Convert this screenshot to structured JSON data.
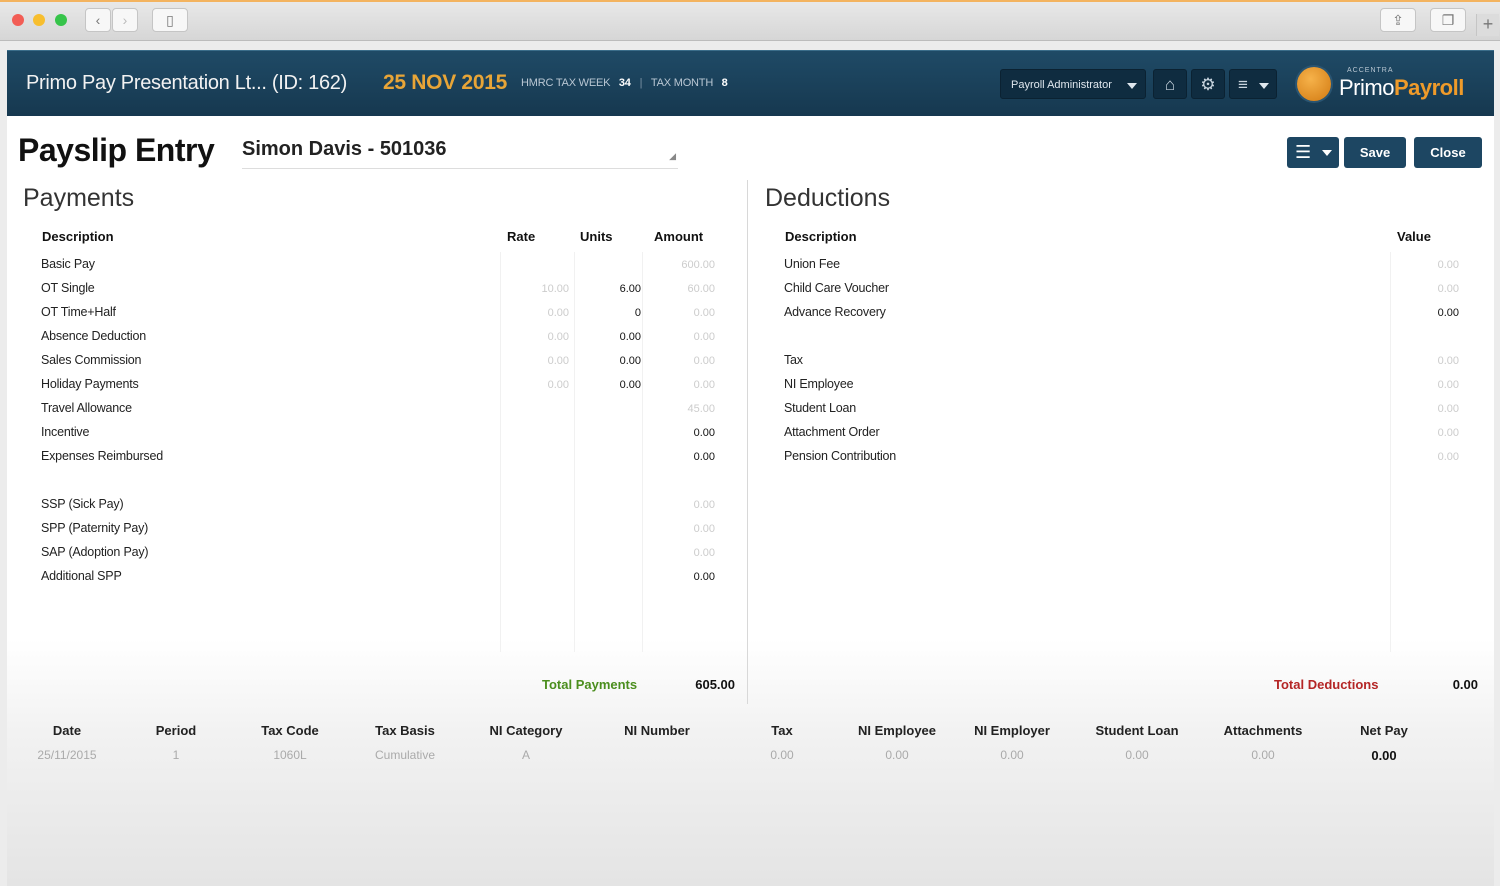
{
  "app": {
    "company": "Primo Pay Presentation Lt... (ID: 162)",
    "date": "25 NOV 2015",
    "hmrc_week_label": "HMRC TAX WEEK",
    "hmrc_week": "34",
    "tax_month_label": "TAX MONTH",
    "tax_month": "8",
    "user_role": "Payroll Administrator",
    "logo_small": "ACCENTRA",
    "logo_primary": "Primo",
    "logo_secondary": "Payroll"
  },
  "page": {
    "title": "Payslip Entry",
    "employee": "Simon Davis - 501036",
    "save_label": "Save",
    "close_label": "Close"
  },
  "payments": {
    "title": "Payments",
    "headers": {
      "description": "Description",
      "rate": "Rate",
      "units": "Units",
      "amount": "Amount"
    },
    "rows": [
      {
        "desc": "Basic Pay",
        "rate": "",
        "units": "",
        "amount": "600.00"
      },
      {
        "desc": "OT Single",
        "rate": "10.00",
        "units": "6.00",
        "amount": "60.00"
      },
      {
        "desc": "OT Time+Half",
        "rate": "0.00",
        "units": "0",
        "amount": "0.00"
      },
      {
        "desc": "Absence Deduction",
        "rate": "0.00",
        "units": "0.00",
        "amount": "0.00"
      },
      {
        "desc": "Sales Commission",
        "rate": "0.00",
        "units": "0.00",
        "amount": "0.00"
      },
      {
        "desc": "Holiday Payments",
        "rate": "0.00",
        "units": "0.00",
        "amount": "0.00"
      },
      {
        "desc": "Travel Allowance",
        "rate": "",
        "units": "",
        "amount": "45.00"
      },
      {
        "desc": "Incentive",
        "rate": "",
        "units": "",
        "amount": "0.00"
      },
      {
        "desc": "Expenses Reimbursed",
        "rate": "",
        "units": "",
        "amount": "0.00"
      },
      {
        "desc": "",
        "rate": "",
        "units": "",
        "amount": ""
      },
      {
        "desc": "SSP (Sick Pay)",
        "rate": "",
        "units": "",
        "amount": "0.00"
      },
      {
        "desc": "SPP (Paternity Pay)",
        "rate": "",
        "units": "",
        "amount": "0.00"
      },
      {
        "desc": "SAP (Adoption Pay)",
        "rate": "",
        "units": "",
        "amount": "0.00"
      },
      {
        "desc": "Additional SPP",
        "rate": "",
        "units": "",
        "amount": "0.00"
      }
    ],
    "total_label": "Total Payments",
    "total_value": "605.00"
  },
  "deductions": {
    "title": "Deductions",
    "headers": {
      "description": "Description",
      "value": "Value"
    },
    "rows": [
      {
        "desc": "Union Fee",
        "value": "0.00"
      },
      {
        "desc": "Child Care Voucher",
        "value": "0.00"
      },
      {
        "desc": "Advance Recovery",
        "value": "0.00"
      },
      {
        "desc": "",
        "value": ""
      },
      {
        "desc": "Tax",
        "value": "0.00"
      },
      {
        "desc": "NI Employee",
        "value": "0.00"
      },
      {
        "desc": "Student Loan",
        "value": "0.00"
      },
      {
        "desc": "Attachment Order",
        "value": "0.00"
      },
      {
        "desc": "Pension Contribution",
        "value": "0.00"
      }
    ],
    "total_label": "Total Deductions",
    "total_value": "0.00"
  },
  "summary": {
    "headers": [
      "Date",
      "Period",
      "Tax Code",
      "Tax Basis",
      "NI Category",
      "NI Number",
      "Tax",
      "NI Employee",
      "NI Employer",
      "Student Loan",
      "Attachments",
      "Net Pay"
    ],
    "values": [
      "25/11/2015",
      "1",
      "1060L",
      "Cumulative",
      "A",
      "",
      "0.00",
      "0.00",
      "0.00",
      "0.00",
      "0.00",
      "0.00"
    ]
  }
}
